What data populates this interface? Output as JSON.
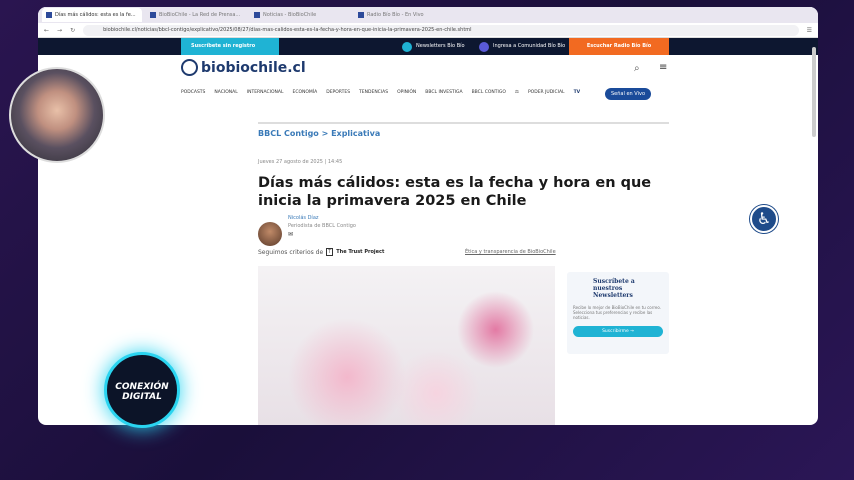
{
  "browser": {
    "tabs": [
      "Días más cálidos: esta es la fe...",
      "BioBioChile - La Red de Prensa...",
      "Noticias - BioBioChile",
      "Radio Bío Bío - En Vivo"
    ],
    "url": "biobiochile.cl/noticias/bbcl-contigo/explicativo/2025/08/27/dias-mas-calidos-esta-es-la-fecha-y-hora-en-que-inicia-la-primavera-2025-en-chile.shtml"
  },
  "topbar": {
    "subscribe": "Suscríbete sin registro",
    "newsletters": "Newsletters Bío Bío",
    "community": "Ingresa a Comunidad Bío Bío",
    "listen": "Escuchar Radio Bío Bío"
  },
  "site": {
    "logo": "biobiochile.cl",
    "nav": [
      "PODCASTS",
      "NACIONAL",
      "INTERNACIONAL",
      "ECONOMÍA",
      "DEPORTES",
      "TENDENCIAS",
      "OPINIÓN",
      "BBCL INVESTIGA",
      "BBCL CONTIGO"
    ],
    "poder": "PODER JUDICIAL",
    "tv": "TV",
    "envivo": "Señal en Vivo"
  },
  "article": {
    "breadcrumb": "BBCL Contigo > Explicativa",
    "date": "Jueves 27 agosto de 2025 | 14:45",
    "title": "Días más cálidos: esta es la fecha y hora en que inicia la primavera 2025 en Chile",
    "author": "Nicolás Díaz",
    "role": "Periodista de BBCL Contigo",
    "criteria": "Seguimos criterios de",
    "trust": "The Trust Project",
    "ethics": "Ética y transparencia de BioBioChile"
  },
  "newsletter": {
    "title": "Suscríbete a nuestros Newsletters",
    "text": "Recibe lo mejor de BioBioChile en tu correo. Selecciona tus preferencias y recibe las noticias.",
    "button": "Suscribirme →"
  },
  "overlay": {
    "badge": "CONEXIÓN DIGITAL"
  }
}
